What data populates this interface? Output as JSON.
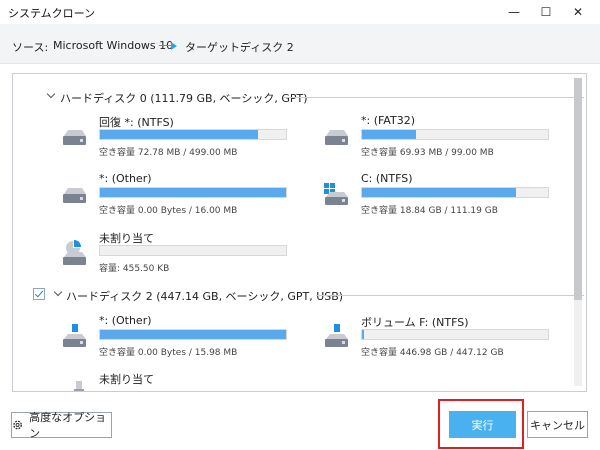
{
  "window": {
    "title": "システムクローン",
    "minimize_glyph": "—",
    "maximize_glyph": "☐",
    "close_glyph": "✕"
  },
  "header": {
    "source_label": "ソース:",
    "source_value": "Microsoft Windows 10",
    "target_label": "ターゲット:",
    "target_value": "ディスク 2"
  },
  "disks": [
    {
      "label": "ハードディスク 0 (111.79 GB, ベーシック, GPT)",
      "partitions": [
        {
          "name": "回復 *: (NTFS)",
          "size": "空き容量 72.78 MB / 499.00 MB",
          "fill": 0.85,
          "icon": "drive-icon"
        },
        {
          "name": "*: (FAT32)",
          "size": "空き容量 69.93 MB / 99.00 MB",
          "fill": 0.29,
          "icon": "drive-icon"
        },
        {
          "name": "*: (Other)",
          "size": "空き容量 0.00 Bytes / 16.00 MB",
          "fill": 1.0,
          "icon": "drive-icon"
        },
        {
          "name": "C: (NTFS)",
          "size": "空き容量 18.84 GB / 111.19 GB",
          "fill": 0.83,
          "icon": "windows-drive-icon"
        },
        {
          "name": "未割り当て",
          "size": "容量: 455.50 KB",
          "fill": 0.0,
          "icon": "unallocated-icon"
        }
      ]
    },
    {
      "label": "ハードディスク 2 (447.14 GB, ベーシック, GPT, USB)",
      "checked": true,
      "partitions": [
        {
          "name": "*: (Other)",
          "size": "空き容量 0.00 Bytes / 15.98 MB",
          "fill": 1.0,
          "icon": "usb-drive-icon"
        },
        {
          "name": "ボリューム F: (NTFS)",
          "size": "空き容量 446.98 GB / 447.12 GB",
          "fill": 0.01,
          "icon": "usb-drive-icon"
        },
        {
          "name": "未割り当て",
          "size": "",
          "fill": 0.0,
          "icon": "usb-drive-icon"
        }
      ]
    }
  ],
  "footer": {
    "advanced_label": "高度なオプション",
    "execute_label": "実行",
    "cancel_label": "キャンセル"
  },
  "colors": {
    "accent": "#4ab1f0",
    "bar_fill": "#5aa9ec",
    "highlight": "#e02020"
  }
}
